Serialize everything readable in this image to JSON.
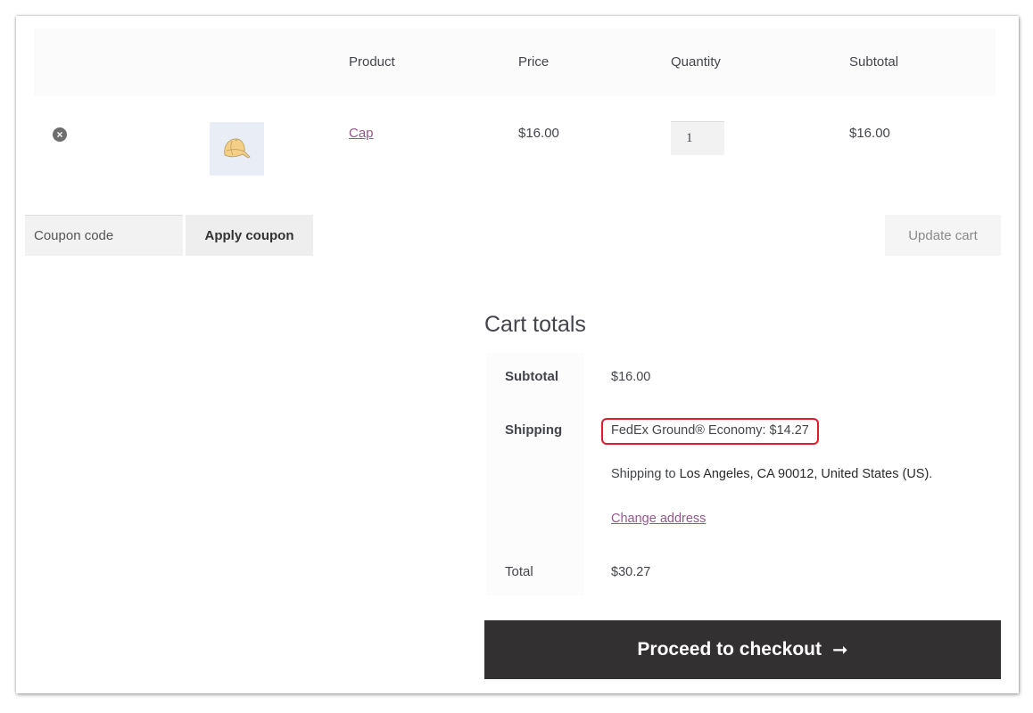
{
  "cart_table": {
    "headers": {
      "product": "Product",
      "price": "Price",
      "quantity": "Quantity",
      "subtotal": "Subtotal"
    },
    "rows": [
      {
        "remove_icon": "remove-circle-x-icon",
        "remove_glyph": "×",
        "thumbnail": "cap-image",
        "product": "Cap",
        "price": "$16.00",
        "quantity": "1",
        "subtotal": "$16.00"
      }
    ]
  },
  "actions": {
    "coupon_placeholder": "Coupon code",
    "apply_coupon": "Apply coupon",
    "update_cart": "Update cart"
  },
  "cart_totals": {
    "title": "Cart totals",
    "subtotal_label": "Subtotal",
    "subtotal_value": "$16.00",
    "shipping_label": "Shipping",
    "shipping_method": "FedEx Ground® Economy: $14.27",
    "shipping_to_prefix": "Shipping to ",
    "shipping_destination": "Los Angeles, CA 90012, United States (US)",
    "shipping_to_suffix": ".",
    "change_address": "Change address",
    "total_label": "Total",
    "total_value": "$30.27"
  },
  "checkout": {
    "label": "Proceed to checkout",
    "arrow": "➞"
  },
  "colors": {
    "link": "#96588a",
    "highlight": "#e31c2b",
    "checkout_bg": "#333031"
  }
}
